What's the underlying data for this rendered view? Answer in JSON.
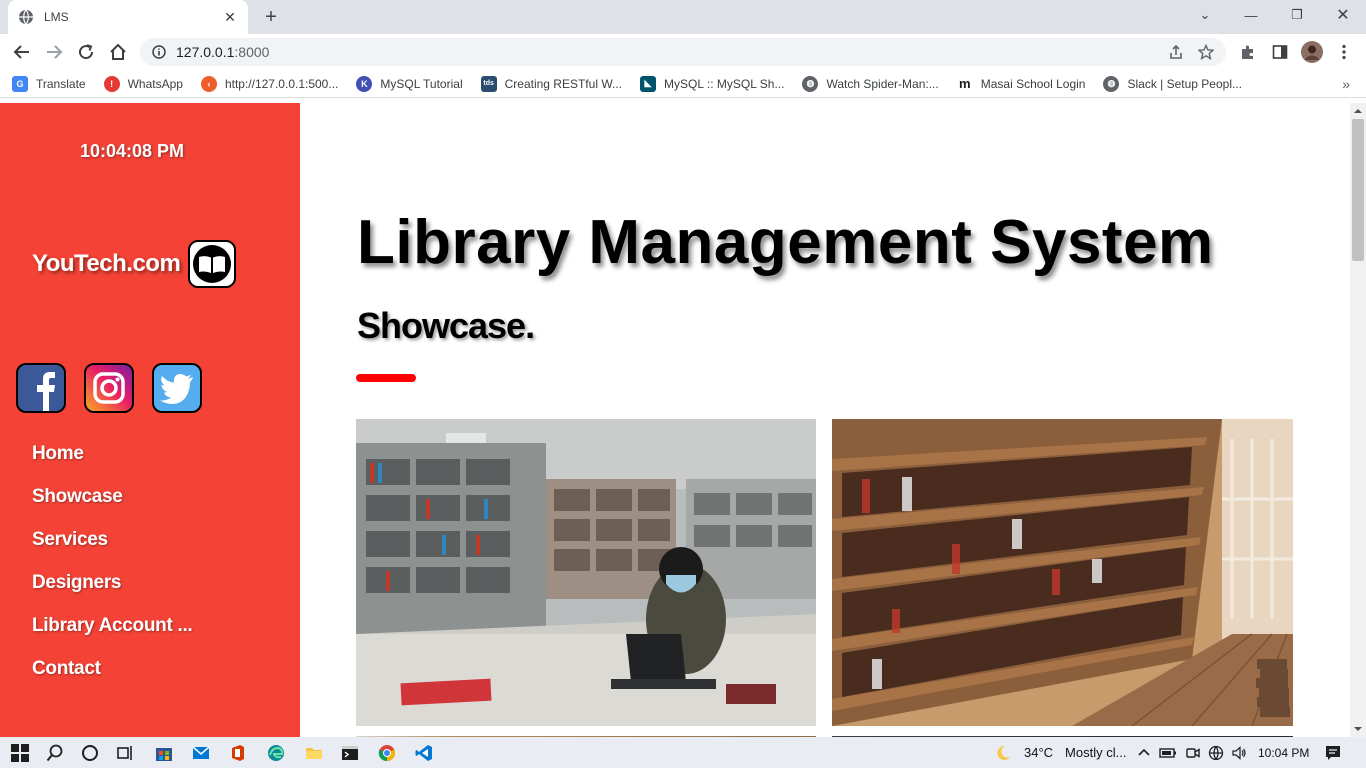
{
  "browser": {
    "tab_title": "LMS",
    "url_host": "127.0.0.1",
    "url_port": ":8000",
    "bookmarks": [
      {
        "label": "Translate",
        "icon": "google-translate-icon",
        "color": "#4285f4"
      },
      {
        "label": "WhatsApp",
        "icon": "whatsapp-icon",
        "color": "#e53935"
      },
      {
        "label": "http://127.0.0.1:500...",
        "icon": "codeigniter-icon",
        "color": "#ee5d2b"
      },
      {
        "label": "MySQL Tutorial",
        "icon": "mysql-tutorial-icon",
        "color": "#3f51b5"
      },
      {
        "label": "Creating RESTful W...",
        "icon": "tds-icon",
        "color": "#2b4c6f"
      },
      {
        "label": "MySQL :: MySQL Sh...",
        "icon": "mysql-icon",
        "color": "#00546b"
      },
      {
        "label": "Watch Spider-Man:...",
        "icon": "globe-icon",
        "color": "#5f6368"
      },
      {
        "label": "Masai School Login",
        "icon": "masai-icon",
        "color": "#202124"
      },
      {
        "label": "Slack | Setup Peopl...",
        "icon": "globe-icon",
        "color": "#5f6368"
      }
    ]
  },
  "sidebar": {
    "clock": "10:04:08 PM",
    "brand": "YouTech.com",
    "social": [
      "facebook-icon",
      "instagram-icon",
      "twitter-icon"
    ],
    "nav": [
      "Home",
      "Showcase",
      "Services",
      "Designers",
      "Library Account ...",
      "Contact"
    ],
    "color": "#f44336"
  },
  "main": {
    "title": "Library Management System",
    "subtitle": "Showcase.",
    "accent": "#ff0000"
  },
  "taskbar": {
    "temperature": "34°C",
    "weather": "Mostly cl...",
    "time": "10:04 PM"
  }
}
